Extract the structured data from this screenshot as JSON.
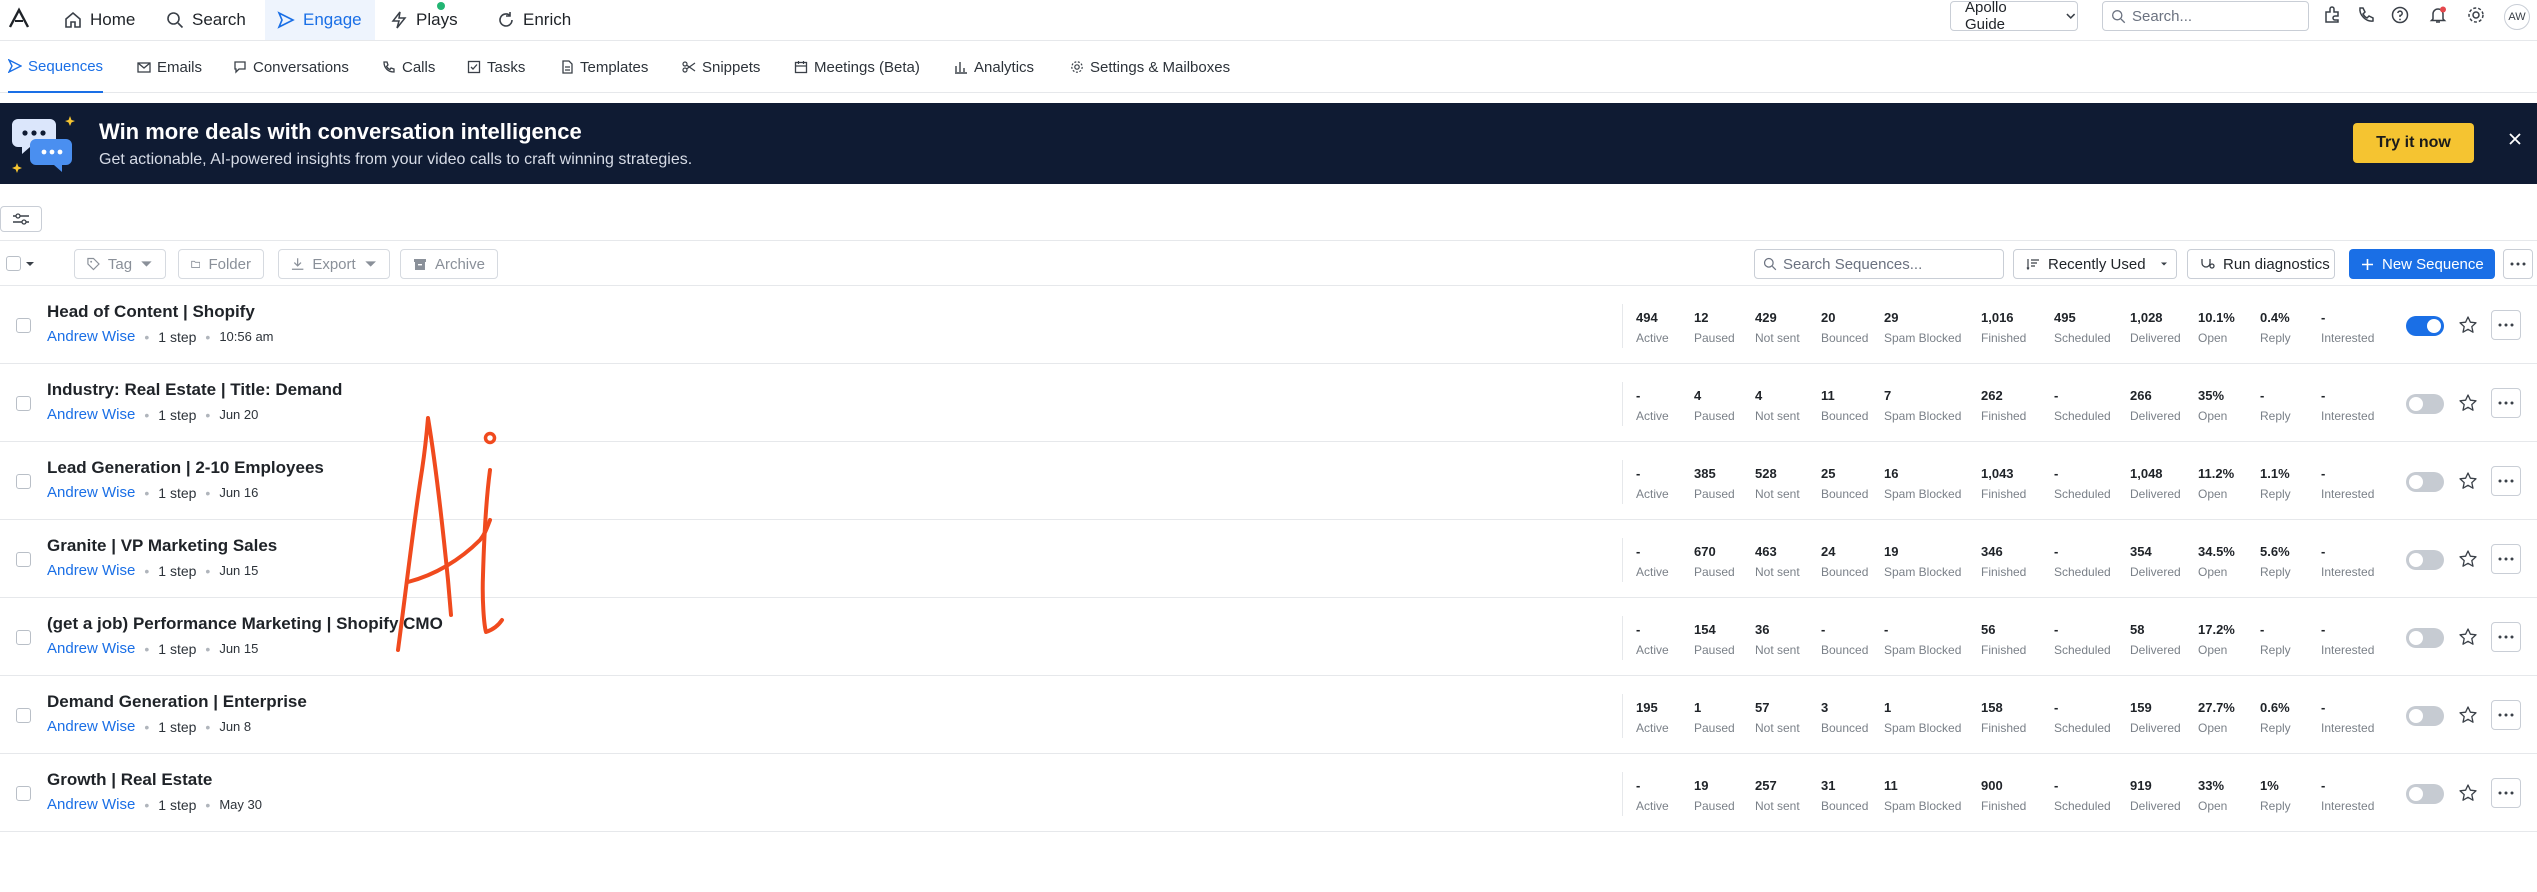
{
  "topnav": {
    "items": [
      {
        "label": "Home",
        "icon": "home-icon"
      },
      {
        "label": "Search",
        "icon": "search-icon"
      },
      {
        "label": "Engage",
        "icon": "send-icon",
        "active": true
      },
      {
        "label": "Plays",
        "icon": "lightning-icon",
        "has_dot": true
      },
      {
        "label": "Enrich",
        "icon": "refresh-icon"
      }
    ],
    "workspace": "Apollo Guide",
    "search_placeholder": "Search...",
    "avatar": "AW"
  },
  "subnav": {
    "items": [
      {
        "label": "Sequences",
        "active": true
      },
      {
        "label": "Emails"
      },
      {
        "label": "Conversations"
      },
      {
        "label": "Calls"
      },
      {
        "label": "Tasks"
      },
      {
        "label": "Templates"
      },
      {
        "label": "Snippets"
      },
      {
        "label": "Meetings (Beta)"
      },
      {
        "label": "Analytics"
      },
      {
        "label": "Settings & Mailboxes"
      }
    ]
  },
  "banner": {
    "title": "Win more deals with conversation intelligence",
    "subtitle": "Get actionable, AI-powered insights from your video calls to craft winning strategies.",
    "cta": "Try it now",
    "background": "#0f1b33",
    "cta_color": "#f5c431"
  },
  "toolbar": {
    "tag": "Tag",
    "folder": "Folder",
    "export": "Export",
    "archive": "Archive",
    "search_placeholder": "Search Sequences...",
    "sort": "Recently Used",
    "diagnostics": "Run diagnostics",
    "new_sequence": "New Sequence",
    "accent": "#1a6fe6"
  },
  "stat_labels": [
    "Active",
    "Paused",
    "Not sent",
    "Bounced",
    "Spam Blocked",
    "Finished",
    "Scheduled",
    "Delivered",
    "Open",
    "Reply",
    "Interested"
  ],
  "sequences": [
    {
      "title": "Head of Content | Shopify",
      "owner": "Andrew Wise",
      "steps": "1 step",
      "time": "10:56 am",
      "enabled": true,
      "stats": [
        "494",
        "12",
        "429",
        "20",
        "29",
        "1,016",
        "495",
        "1,028",
        "10.1%",
        "0.4%",
        "-"
      ]
    },
    {
      "title": "Industry: Real Estate | Title: Demand",
      "owner": "Andrew Wise",
      "steps": "1 step",
      "time": "Jun 20",
      "enabled": false,
      "stats": [
        "-",
        "4",
        "4",
        "11",
        "7",
        "262",
        "-",
        "266",
        "35%",
        "-",
        "-"
      ]
    },
    {
      "title": "Lead Generation | 2-10 Employees",
      "owner": "Andrew Wise",
      "steps": "1 step",
      "time": "Jun 16",
      "enabled": false,
      "stats": [
        "-",
        "385",
        "528",
        "25",
        "16",
        "1,043",
        "-",
        "1,048",
        "11.2%",
        "1.1%",
        "-"
      ]
    },
    {
      "title": "Granite | VP Marketing Sales",
      "owner": "Andrew Wise",
      "steps": "1 step",
      "time": "Jun 15",
      "enabled": false,
      "stats": [
        "-",
        "670",
        "463",
        "24",
        "19",
        "346",
        "-",
        "354",
        "34.5%",
        "5.6%",
        "-"
      ]
    },
    {
      "title": "(get a job) Performance Marketing | Shopify CMO",
      "owner": "Andrew Wise",
      "steps": "1 step",
      "time": "Jun 15",
      "enabled": false,
      "stats": [
        "-",
        "154",
        "36",
        "-",
        "-",
        "56",
        "-",
        "58",
        "17.2%",
        "-",
        "-"
      ]
    },
    {
      "title": "Demand Generation | Enterprise",
      "owner": "Andrew Wise",
      "steps": "1 step",
      "time": "Jun 8",
      "enabled": false,
      "stats": [
        "195",
        "1",
        "57",
        "3",
        "1",
        "158",
        "-",
        "159",
        "27.7%",
        "0.6%",
        "-"
      ]
    },
    {
      "title": "Growth | Real Estate",
      "owner": "Andrew Wise",
      "steps": "1 step",
      "time": "May 30",
      "enabled": false,
      "stats": [
        "-",
        "19",
        "257",
        "31",
        "11",
        "900",
        "-",
        "919",
        "33%",
        "1%",
        "-"
      ]
    }
  ],
  "annotation": {
    "color": "#f04a1e"
  }
}
